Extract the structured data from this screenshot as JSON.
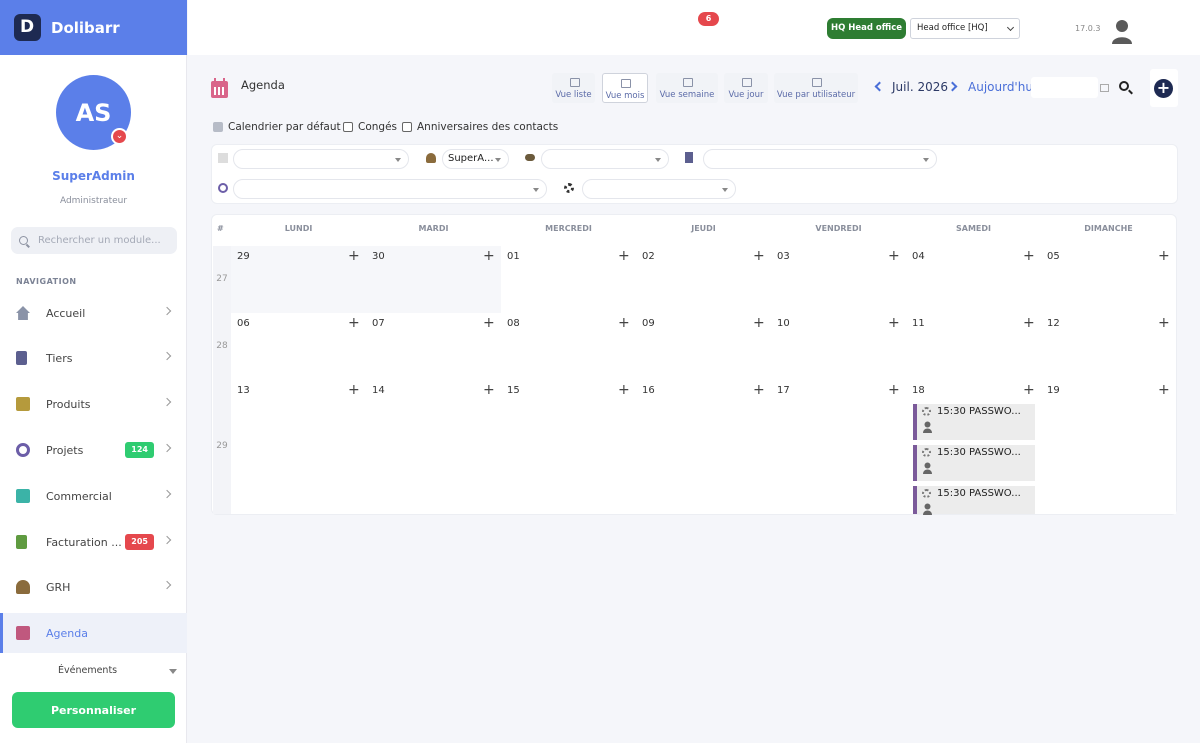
{
  "app": {
    "name": "Dolibarr",
    "version": "17.0.3",
    "notification_count": "6"
  },
  "user": {
    "initials": "AS",
    "name": "SuperAdmin",
    "role": "Administrateur"
  },
  "sidebar": {
    "search_placeholder": "Rechercher un module...",
    "nav_heading": "NAVIGATION",
    "items": [
      {
        "label": "Accueil",
        "icon": "home-icon"
      },
      {
        "label": "Tiers",
        "icon": "building-icon"
      },
      {
        "label": "Produits",
        "icon": "box-icon"
      },
      {
        "label": "Projets",
        "icon": "project-icon",
        "badge": "124",
        "badge_color": "#2fcc71"
      },
      {
        "label": "Commercial",
        "icon": "briefcase-icon"
      },
      {
        "label": "Facturation ...",
        "icon": "invoice-icon",
        "badge": "205",
        "badge_color": "#e5484d"
      },
      {
        "label": "GRH",
        "icon": "user-tie-icon"
      },
      {
        "label": "Agenda",
        "icon": "calendar-icon",
        "active": true
      }
    ],
    "sub_item": "Événements",
    "customize_label": "Personnaliser"
  },
  "topbar": {
    "entity_badge": "HQ Head office",
    "entity_select": "Head office [HQ]"
  },
  "agenda": {
    "title": "Agenda",
    "views": [
      {
        "label": "Vue liste"
      },
      {
        "label": "Vue mois",
        "active": true
      },
      {
        "label": "Vue semaine"
      },
      {
        "label": "Vue jour"
      },
      {
        "label": "Vue par utilisateur"
      }
    ],
    "month_label": "Juil. 2026",
    "today_label": "Aujourd'hui",
    "checkboxes": [
      {
        "label": "Calendrier par défaut",
        "checked": true
      },
      {
        "label": "Congés",
        "checked": false
      },
      {
        "label": "Anniversaires des contacts",
        "checked": false
      }
    ],
    "filters": {
      "user_value": "SuperA..."
    },
    "calendar": {
      "week_header": "#",
      "day_headers": [
        "LUNDI",
        "MARDI",
        "MERCREDI",
        "JEUDI",
        "VENDREDI",
        "SAMEDI",
        "DIMANCHE"
      ],
      "weeks": [
        {
          "number": "27",
          "days": [
            "29",
            "30",
            "01",
            "02",
            "03",
            "04",
            "05"
          ]
        },
        {
          "number": "28",
          "days": [
            "06",
            "07",
            "08",
            "09",
            "10",
            "11",
            "12"
          ]
        },
        {
          "number": "29",
          "days": [
            "13",
            "14",
            "15",
            "16",
            "17",
            "18",
            "19"
          ]
        }
      ],
      "events": [
        {
          "text": "15:30 PASSWO..."
        },
        {
          "text": "15:30 PASSWO..."
        },
        {
          "text": "15:30 PASSWO..."
        }
      ]
    }
  }
}
